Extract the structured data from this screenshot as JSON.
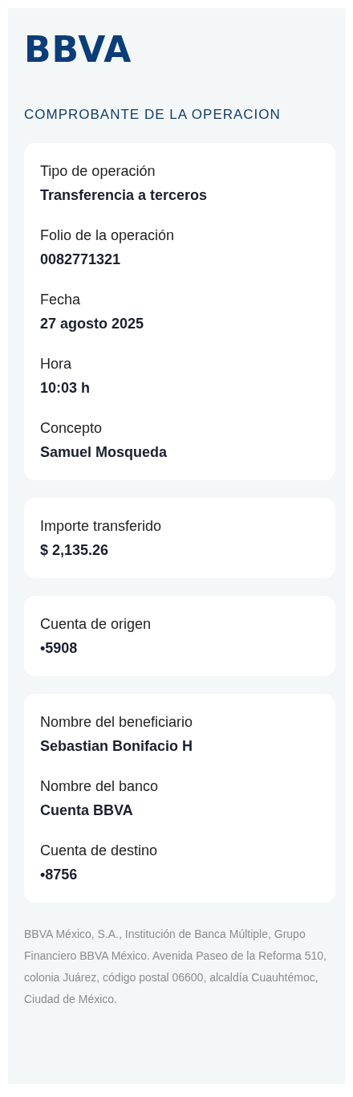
{
  "logo": "BBVA",
  "title": "COMPROBANTE DE LA OPERACION",
  "cards": [
    {
      "fields": [
        {
          "label": "Tipo de operación",
          "value": "Transferencia a terceros"
        },
        {
          "label": "Folio de la operación",
          "value": "0082771321"
        },
        {
          "label": "Fecha",
          "value": "27 agosto 2025"
        },
        {
          "label": "Hora",
          "value": "10:03 h"
        },
        {
          "label": "Concepto",
          "value": "Samuel Mosqueda"
        }
      ]
    },
    {
      "fields": [
        {
          "label": "Importe transferido",
          "value": "$ 2,135.26"
        }
      ]
    },
    {
      "fields": [
        {
          "label": "Cuenta de origen",
          "value": "•5908"
        }
      ]
    },
    {
      "fields": [
        {
          "label": "Nombre del beneficiario",
          "value": "Sebastian Bonifacio H"
        },
        {
          "label": "Nombre del banco",
          "value": "Cuenta BBVA"
        },
        {
          "label": "Cuenta de destino",
          "value": "•8756"
        }
      ]
    }
  ],
  "footer": "BBVA México, S.A., Institución de Banca Múltiple, Grupo Financiero BBVA México. Avenida Paseo de la Reforma 510, colonia Juárez, código postal 06600, alcaldía Cuauhtémoc, Ciudad de México."
}
